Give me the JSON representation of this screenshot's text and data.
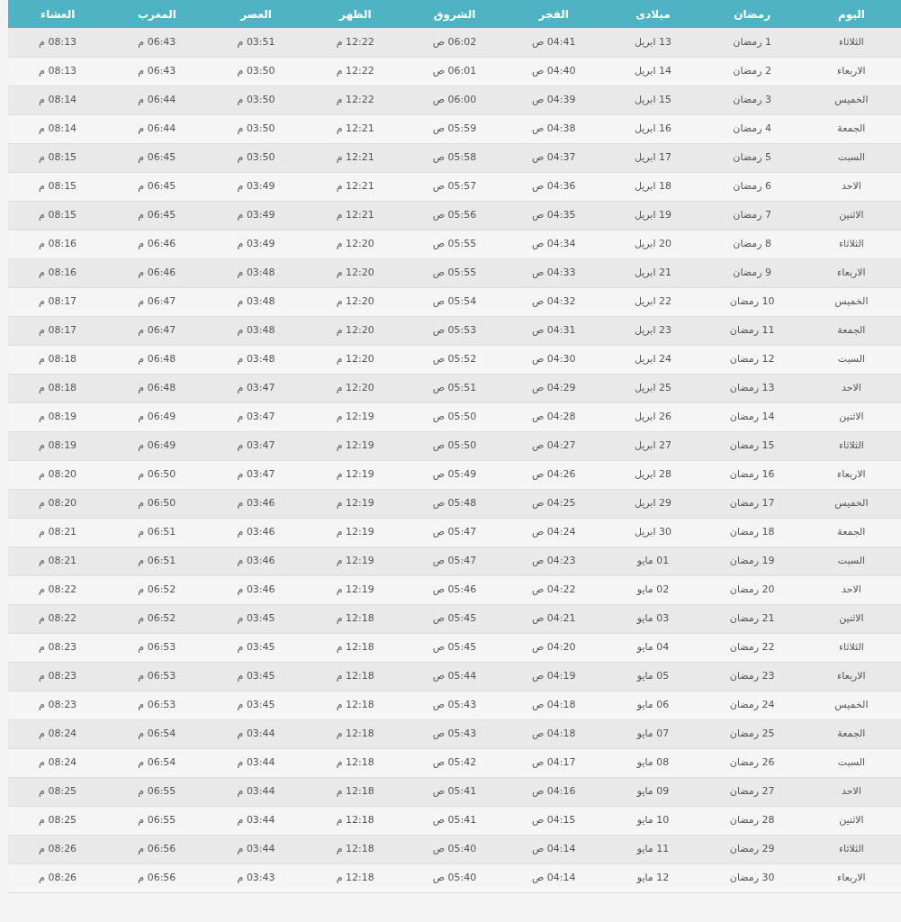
{
  "table": {
    "columns": [
      "اليوم",
      "رمضان",
      "ميلادى",
      "الفجر",
      "الشروق",
      "الظهر",
      "العصر",
      "المغرب",
      "العشاء"
    ],
    "rows": [
      [
        "الثلاثاء",
        "1 رمضان",
        "13 ابريل",
        "04:41 ص",
        "06:02 ص",
        "12:22 م",
        "03:51 م",
        "06:43 م",
        "08:13 م"
      ],
      [
        "الاربعاء",
        "2 رمضان",
        "14 ابريل",
        "04:40 ص",
        "06:01 ص",
        "12:22 م",
        "03:50 م",
        "06:43 م",
        "08:13 م"
      ],
      [
        "الخميس",
        "3 رمضان",
        "15 ابريل",
        "04:39 ص",
        "06:00 ص",
        "12:22 م",
        "03:50 م",
        "06:44 م",
        "08:14 م"
      ],
      [
        "الجمعة",
        "4 رمضان",
        "16 ابريل",
        "04:38 ص",
        "05:59 ص",
        "12:21 م",
        "03:50 م",
        "06:44 م",
        "08:14 م"
      ],
      [
        "السبت",
        "5 رمضان",
        "17 ابريل",
        "04:37 ص",
        "05:58 ص",
        "12:21 م",
        "03:50 م",
        "06:45 م",
        "08:15 م"
      ],
      [
        "الاحد",
        "6 رمضان",
        "18 ابريل",
        "04:36 ص",
        "05:57 ص",
        "12:21 م",
        "03:49 م",
        "06:45 م",
        "08:15 م"
      ],
      [
        "الاثنين",
        "7 رمضان",
        "19 ابريل",
        "04:35 ص",
        "05:56 ص",
        "12:21 م",
        "03:49 م",
        "06:45 م",
        "08:15 م"
      ],
      [
        "الثلاثاء",
        "8 رمضان",
        "20 ابريل",
        "04:34 ص",
        "05:55 ص",
        "12:20 م",
        "03:49 م",
        "06:46 م",
        "08:16 م"
      ],
      [
        "الاربعاء",
        "9 رمضان",
        "21 ابريل",
        "04:33 ص",
        "05:55 ص",
        "12:20 م",
        "03:48 م",
        "06:46 م",
        "08:16 م"
      ],
      [
        "الخميس",
        "10 رمضان",
        "22 ابريل",
        "04:32 ص",
        "05:54 ص",
        "12:20 م",
        "03:48 م",
        "06:47 م",
        "08:17 م"
      ],
      [
        "الجمعة",
        "11 رمضان",
        "23 ابريل",
        "04:31 ص",
        "05:53 ص",
        "12:20 م",
        "03:48 م",
        "06:47 م",
        "08:17 م"
      ],
      [
        "السبت",
        "12 رمضان",
        "24 ابريل",
        "04:30 ص",
        "05:52 ص",
        "12:20 م",
        "03:48 م",
        "06:48 م",
        "08:18 م"
      ],
      [
        "الاحد",
        "13 رمضان",
        "25 ابريل",
        "04:29 ص",
        "05:51 ص",
        "12:20 م",
        "03:47 م",
        "06:48 م",
        "08:18 م"
      ],
      [
        "الاثنين",
        "14 رمضان",
        "26 ابريل",
        "04:28 ص",
        "05:50 ص",
        "12:19 م",
        "03:47 م",
        "06:49 م",
        "08:19 م"
      ],
      [
        "الثلاثاء",
        "15 رمضان",
        "27 ابريل",
        "04:27 ص",
        "05:50 ص",
        "12:19 م",
        "03:47 م",
        "06:49 م",
        "08:19 م"
      ],
      [
        "الاربعاء",
        "16 رمضان",
        "28 ابريل",
        "04:26 ص",
        "05:49 ص",
        "12:19 م",
        "03:47 م",
        "06:50 م",
        "08:20 م"
      ],
      [
        "الخميس",
        "17 رمضان",
        "29 ابريل",
        "04:25 ص",
        "05:48 ص",
        "12:19 م",
        "03:46 م",
        "06:50 م",
        "08:20 م"
      ],
      [
        "الجمعة",
        "18 رمضان",
        "30 ابريل",
        "04:24 ص",
        "05:47 ص",
        "12:19 م",
        "03:46 م",
        "06:51 م",
        "08:21 م"
      ],
      [
        "السبت",
        "19 رمضان",
        "01 مايو",
        "04:23 ص",
        "05:47 ص",
        "12:19 م",
        "03:46 م",
        "06:51 م",
        "08:21 م"
      ],
      [
        "الاحد",
        "20 رمضان",
        "02 مايو",
        "04:22 ص",
        "05:46 ص",
        "12:19 م",
        "03:46 م",
        "06:52 م",
        "08:22 م"
      ],
      [
        "الاثنين",
        "21 رمضان",
        "03 مايو",
        "04:21 ص",
        "05:45 ص",
        "12:18 م",
        "03:45 م",
        "06:52 م",
        "08:22 م"
      ],
      [
        "الثلاثاء",
        "22 رمضان",
        "04 مايو",
        "04:20 ص",
        "05:45 ص",
        "12:18 م",
        "03:45 م",
        "06:53 م",
        "08:23 م"
      ],
      [
        "الاربعاء",
        "23 رمضان",
        "05 مايو",
        "04:19 ص",
        "05:44 ص",
        "12:18 م",
        "03:45 م",
        "06:53 م",
        "08:23 م"
      ],
      [
        "الخميس",
        "24 رمضان",
        "06 مايو",
        "04:18 ص",
        "05:43 ص",
        "12:18 م",
        "03:45 م",
        "06:53 م",
        "08:23 م"
      ],
      [
        "الجمعة",
        "25 رمضان",
        "07 مايو",
        "04:18 ص",
        "05:43 ص",
        "12:18 م",
        "03:44 م",
        "06:54 م",
        "08:24 م"
      ],
      [
        "السبت",
        "26 رمضان",
        "08 مايو",
        "04:17 ص",
        "05:42 ص",
        "12:18 م",
        "03:44 م",
        "06:54 م",
        "08:24 م"
      ],
      [
        "الاحد",
        "27 رمضان",
        "09 مايو",
        "04:16 ص",
        "05:41 ص",
        "12:18 م",
        "03:44 م",
        "06:55 م",
        "08:25 م"
      ],
      [
        "الاثنين",
        "28 رمضان",
        "10 مايو",
        "04:15 ص",
        "05:41 ص",
        "12:18 م",
        "03:44 م",
        "06:55 م",
        "08:25 م"
      ],
      [
        "الثلاثاء",
        "29 رمضان",
        "11 مايو",
        "04:14 ص",
        "05:40 ص",
        "12:18 م",
        "03:44 م",
        "06:56 م",
        "08:26 م"
      ],
      [
        "الاربعاء",
        "30 رمضان",
        "12 مايو",
        "04:14 ص",
        "05:40 ص",
        "12:18 م",
        "03:43 م",
        "06:56 م",
        "08:26 م"
      ]
    ]
  }
}
